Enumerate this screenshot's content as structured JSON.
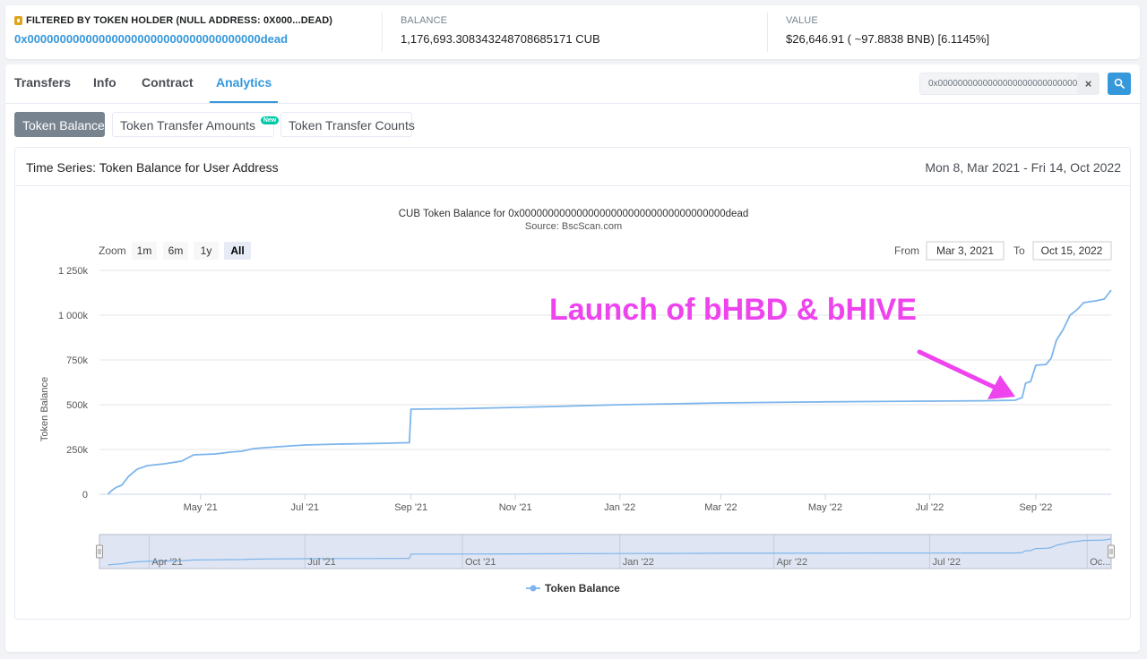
{
  "summary": {
    "filter_label": "FILTERED BY TOKEN HOLDER (Null Address: 0x000...dEaD)",
    "address": "0x000000000000000000000000000000000000dead",
    "balance_label": "BALANCE",
    "balance_value": "1,176,693.308343248708685171 CUB",
    "value_label": "VALUE",
    "value_value": "$26,646.91 ( ~97.8838 BNB) [6.1145%]"
  },
  "tabs": [
    "Transfers",
    "Info",
    "Contract",
    "Analytics"
  ],
  "active_tab": "Analytics",
  "search": {
    "value": "0x000000000000000000000000000000...",
    "clear_label": "×"
  },
  "subtabs": {
    "token_balance": "Token Balance",
    "transfer_amounts": "Token Transfer Amounts",
    "new_badge": "New",
    "transfer_counts": "Token Transfer Counts"
  },
  "chart_card": {
    "title": "Time Series: Token Balance for User Address",
    "range": "Mon 8, Mar 2021 - Fri 14, Oct 2022"
  },
  "zoom": {
    "label": "Zoom",
    "buttons": [
      "1m",
      "6m",
      "1y",
      "All"
    ],
    "selected": "All"
  },
  "range_inputs": {
    "from_label": "From",
    "from_value": "Mar 3, 2021",
    "to_label": "To",
    "to_value": "Oct 15, 2022"
  },
  "annotation": {
    "text": "Launch of bHBD & bHIVE",
    "color": "#ee44ee"
  },
  "colors": {
    "accent": "#3498db",
    "series": "#7cb5ec"
  },
  "chart_data": {
    "type": "line",
    "title": "CUB Token Balance for 0x000000000000000000000000000000000000dead",
    "subtitle": "Source: BscScan.com",
    "ylabel": "Token Balance",
    "xlabel": "",
    "ylim": [
      0,
      1250000
    ],
    "y_ticks": [
      0,
      250000,
      500000,
      750000,
      1000000,
      1250000
    ],
    "y_tick_labels": [
      "0",
      "250k",
      "500k",
      "750k",
      "1 000k",
      "1 250k"
    ],
    "x_range": [
      "2021-03-03",
      "2022-10-15"
    ],
    "x_ticks": [
      "2021-05-01",
      "2021-07-01",
      "2021-09-01",
      "2021-11-01",
      "2022-01-01",
      "2022-03-01",
      "2022-05-01",
      "2022-07-01",
      "2022-09-01"
    ],
    "x_tick_labels": [
      "May '21",
      "Jul '21",
      "Sep '21",
      "Nov '21",
      "Jan '22",
      "Mar '22",
      "May '22",
      "Jul '22",
      "Sep '22"
    ],
    "navigator_ticks": [
      "2021-04-01",
      "2021-07-01",
      "2021-10-01",
      "2022-01-01",
      "2022-04-01",
      "2022-07-01",
      "2022-10-01"
    ],
    "navigator_tick_labels": [
      "Apr '21",
      "Jul '21",
      "Oct '21",
      "Jan '22",
      "Apr '22",
      "Jul '22",
      "Oc..."
    ],
    "grid": true,
    "legend": "bottom-center",
    "series": [
      {
        "name": "Token Balance",
        "points": [
          [
            "2021-03-08",
            0
          ],
          [
            "2021-03-10",
            20000
          ],
          [
            "2021-03-13",
            40000
          ],
          [
            "2021-03-16",
            50000
          ],
          [
            "2021-03-20",
            100000
          ],
          [
            "2021-03-25",
            140000
          ],
          [
            "2021-03-31",
            160000
          ],
          [
            "2021-04-10",
            170000
          ],
          [
            "2021-04-20",
            185000
          ],
          [
            "2021-04-27",
            220000
          ],
          [
            "2021-05-10",
            225000
          ],
          [
            "2021-05-18",
            235000
          ],
          [
            "2021-05-25",
            240000
          ],
          [
            "2021-06-01",
            255000
          ],
          [
            "2021-06-15",
            265000
          ],
          [
            "2021-07-01",
            275000
          ],
          [
            "2021-07-20",
            280000
          ],
          [
            "2021-08-10",
            283000
          ],
          [
            "2021-08-31",
            288000
          ],
          [
            "2021-09-01",
            475000
          ],
          [
            "2021-10-01",
            478000
          ],
          [
            "2021-11-01",
            485000
          ],
          [
            "2021-12-01",
            492000
          ],
          [
            "2022-01-01",
            500000
          ],
          [
            "2022-02-01",
            505000
          ],
          [
            "2022-03-01",
            510000
          ],
          [
            "2022-04-01",
            513000
          ],
          [
            "2022-05-01",
            516000
          ],
          [
            "2022-06-01",
            518000
          ],
          [
            "2022-07-01",
            520000
          ],
          [
            "2022-08-01",
            522000
          ],
          [
            "2022-08-20",
            525000
          ],
          [
            "2022-08-24",
            540000
          ],
          [
            "2022-08-26",
            620000
          ],
          [
            "2022-08-29",
            630000
          ],
          [
            "2022-09-01",
            720000
          ],
          [
            "2022-09-07",
            725000
          ],
          [
            "2022-09-10",
            760000
          ],
          [
            "2022-09-13",
            860000
          ],
          [
            "2022-09-17",
            920000
          ],
          [
            "2022-09-21",
            1000000
          ],
          [
            "2022-09-25",
            1030000
          ],
          [
            "2022-09-29",
            1070000
          ],
          [
            "2022-10-06",
            1080000
          ],
          [
            "2022-10-11",
            1090000
          ],
          [
            "2022-10-15",
            1140000
          ]
        ]
      }
    ]
  }
}
